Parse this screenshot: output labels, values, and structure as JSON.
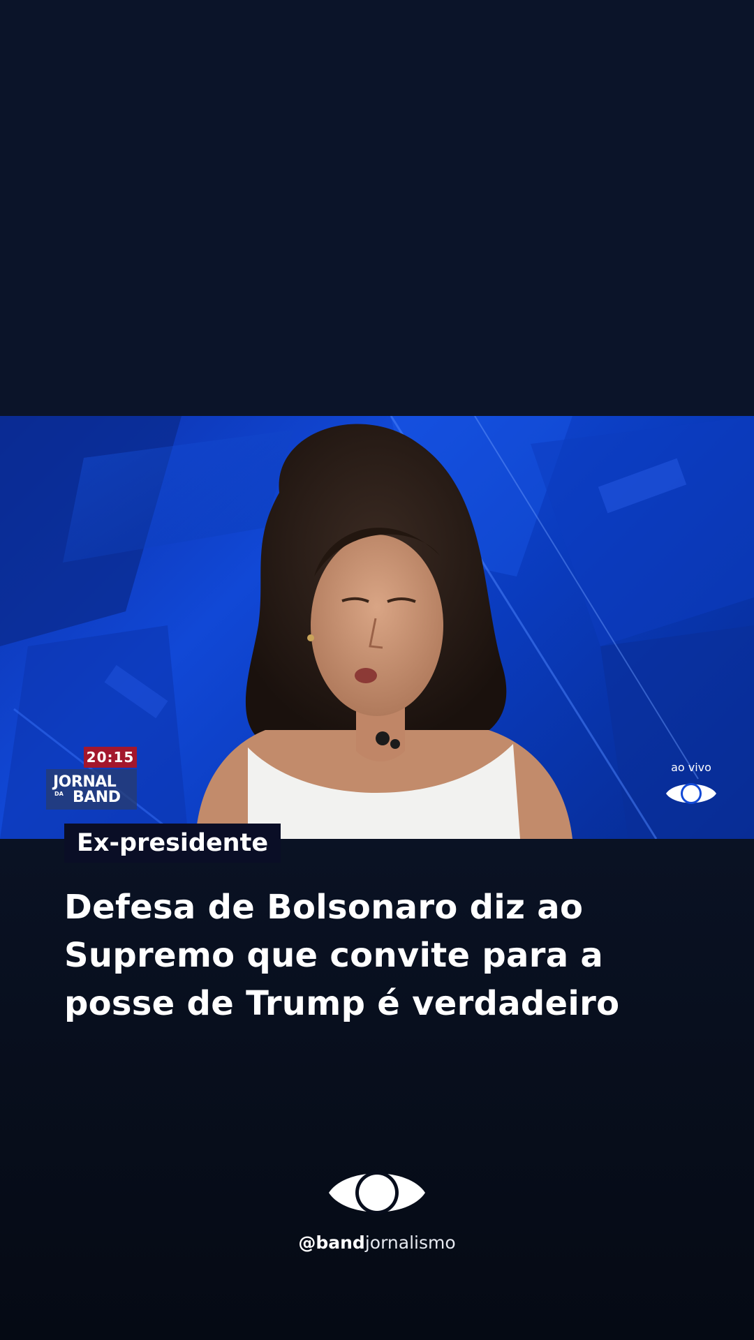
{
  "broadcast": {
    "time": "20:15",
    "show_logo": {
      "line1": "JORNAL",
      "line2": "DA",
      "line3": "BAND"
    },
    "live_label": "ao vivo"
  },
  "story": {
    "category": "Ex-presidente",
    "headline": "Defesa de Bolsonaro diz ao Supremo que convite para a posse de Trump é verdadeiro"
  },
  "brand": {
    "handle_prefix": "@",
    "handle_bold": "band",
    "handle_rest": "jornalismo",
    "logo_icon": "band-eye-icon"
  },
  "colors": {
    "background": "#0b1429",
    "studio_blue": "#1148d6",
    "time_badge": "#a3172d",
    "category_bg": "#0a0e26",
    "text": "#ffffff"
  }
}
